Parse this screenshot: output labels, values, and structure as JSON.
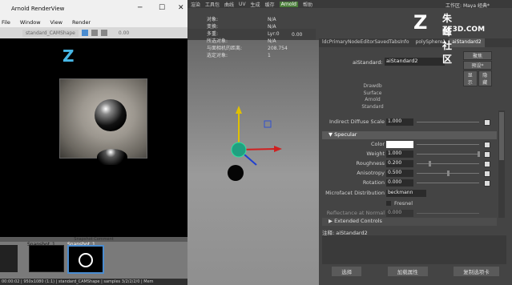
{
  "maya": {
    "menu": [
      "渲染",
      "工具包",
      "曲线",
      "UV",
      "生成",
      "缓存",
      "Arnold",
      "帮助"
    ],
    "workspace_label": "工作区:",
    "workspace_value": "Maya 经典*"
  },
  "arnold": {
    "title": "Arnold RenderView",
    "menus": [
      "File",
      "Window",
      "View",
      "Render"
    ],
    "camera_dropdown": "standard_CAMShape",
    "value_readout": "0.00",
    "snapshot_header": "Snapshot Comment",
    "snapshots": [
      {
        "label": "Snapshot_1..."
      },
      {
        "label": "Snapshot_1..."
      }
    ],
    "status": "00:00:02 | 950x1080 (1:1) | standard_CAMShape | samples 3/2/2/2/0 | Mem"
  },
  "viewport": {
    "value_readout": "0.00",
    "hud": [
      {
        "k": "对象:",
        "v": "N/A"
      },
      {
        "k": "变换:",
        "v": "N/A"
      },
      {
        "k": "多重:",
        "v": "Lyr:0"
      },
      {
        "k": "所选对象:",
        "v": "N/A"
      },
      {
        "k": "与面相机的距离:",
        "v": "208.754"
      },
      {
        "k": "选定对象:",
        "v": "1"
      }
    ]
  },
  "ae": {
    "tabs": [
      "ldcPrimaryNodeEditorSavedTabsInfo",
      "polySphere1",
      "aiStandard2"
    ],
    "node_label": "aiStandard:",
    "node_name": "aiStandard2",
    "side_buttons": [
      "聚焦",
      "预设*",
      "显示",
      "隐藏"
    ],
    "swatch_labels": [
      "Drawdb",
      "Surface",
      "Arnold",
      "Standard"
    ],
    "indirect_diffuse_label": "Indirect Diffuse Scale",
    "indirect_diffuse_value": "1.000",
    "specular_section": "Specular",
    "specular": [
      {
        "label": "Color",
        "value": ""
      },
      {
        "label": "Weight",
        "value": "1.000"
      },
      {
        "label": "Roughness",
        "value": "0.200"
      },
      {
        "label": "Anisotropy",
        "value": "0.500"
      },
      {
        "label": "Rotation",
        "value": "0.000"
      }
    ],
    "microfacet_label": "Microfacet Distribution",
    "microfacet_value": "beckmann",
    "fresnel_label": "Fresnel",
    "reflectance_label": "Reflectance at Normal",
    "reflectance_value": "0.000",
    "extended_section": "Extended Controls",
    "notes_label": "注释:  aiStandard2",
    "bottom_buttons": [
      "选择",
      "加载属性",
      "复制选项卡"
    ]
  },
  "watermark": {
    "glyph": "Z",
    "chinese": "朱峰社区",
    "url": "ZF3D.COM"
  },
  "colors": {
    "arnold_accent": "#47b7e6",
    "selected_tab": "#555555",
    "arnold_menu_tab": "#4a7d3a"
  }
}
